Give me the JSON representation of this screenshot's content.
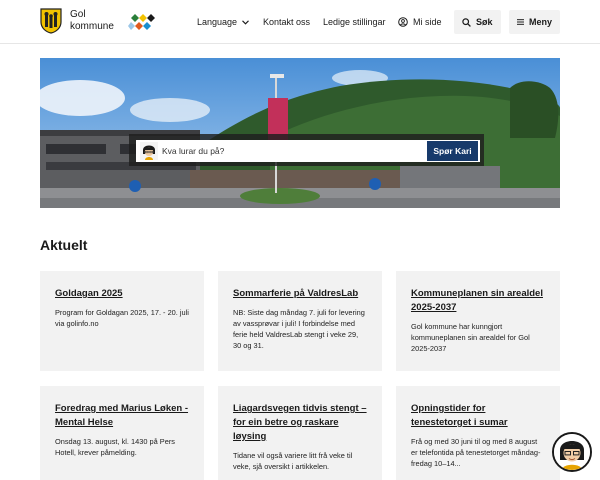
{
  "header": {
    "logo_line1": "Gol",
    "logo_line2": "kommune",
    "language_label": "Language",
    "contact_label": "Kontakt oss",
    "jobs_label": "Ledige stillingar",
    "mypage_label": "Mi side",
    "search_label": "Søk",
    "menu_label": "Meny"
  },
  "hero": {
    "search_placeholder": "Kva lurar du på?",
    "search_button": "Spør Kari"
  },
  "news": {
    "title": "Aktuelt",
    "cards": [
      {
        "title": "Goldagan 2025",
        "text": "Program for Goldagan 2025, 17. - 20. juli via golinfo.no"
      },
      {
        "title": "Sommarferie på ValdresLab",
        "text": "NB: Siste dag måndag 7. juli for levering av vassprøvar i juli! I forbindelse med ferie held ValdresLab stengt i veke 29, 30 og 31."
      },
      {
        "title": "Kommuneplanen sin arealdel 2025-2037",
        "text": "Gol kommune har kunngjort kommuneplanen sin arealdel for Gol 2025-2037"
      },
      {
        "title": "Foredrag med Marius Løken - Mental Helse",
        "text": "Onsdag 13. august, kl. 1430 på Pers Hotell, krever påmelding."
      },
      {
        "title": "Liagardsvegen tidvis stengt – for ein betre og raskare løysing",
        "text": "Tidane vil også variere litt frå veke til veke, sjå oversikt i artikkelen."
      },
      {
        "title": "Opningstider for tenestetorget i sumar",
        "text": "Frå og med 30 juni til og med 8 august er telefontida på tenestetorget måndag-fredag 10–14..."
      }
    ]
  },
  "colors": {
    "brand_navy": "#173a6b",
    "card_bg": "#f2f2f2",
    "logo_yellow": "#f2c200"
  }
}
